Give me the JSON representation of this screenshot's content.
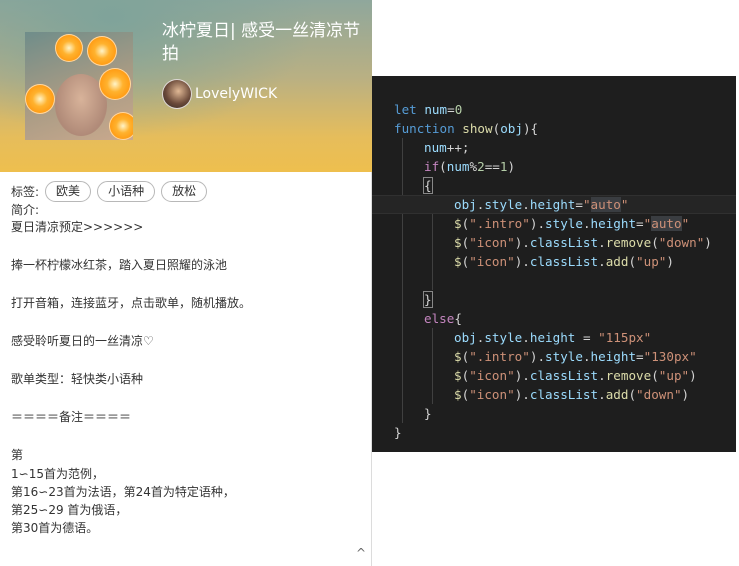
{
  "playlist": {
    "title": "冰柠夏日| 感受一丝清凉节拍",
    "username": "LovelyWICK",
    "tags_label": "标签:",
    "tags": [
      "欧美",
      "小语种",
      "放松"
    ],
    "intro_label": "简介:",
    "intro_lines": [
      "夏日清凉预定>>>>>>",
      "",
      "捧一杯柠檬冰红茶，踏入夏日照耀的泳池",
      "",
      "打开音箱，连接蓝牙，点击歌单，随机播放。",
      "",
      "感受聆听夏日的一丝清凉♡",
      "",
      "歌单类型：轻快类小语种",
      "",
      "＝＝＝＝备注＝＝＝＝",
      "",
      "第",
      "1∽15首为范例，",
      "第16∽23首为法语，第24首为特定语种，",
      "第25∽29 首为俄语，",
      "第30首为德语。"
    ],
    "collapse_icon": "^"
  },
  "code": {
    "lines": [
      {
        "indent": 0,
        "tokens": [
          [
            "kw",
            "let "
          ],
          [
            "v",
            "num"
          ],
          [
            "p",
            "="
          ],
          [
            "num",
            "0"
          ]
        ]
      },
      {
        "indent": 0,
        "tokens": [
          [
            "kw",
            "function "
          ],
          [
            "fn",
            "show"
          ],
          [
            "p",
            "("
          ],
          [
            "v",
            "obj"
          ],
          [
            "p",
            "){"
          ]
        ]
      },
      {
        "indent": 1,
        "tokens": [
          [
            "v",
            "num"
          ],
          [
            "p",
            "++;"
          ]
        ]
      },
      {
        "indent": 1,
        "tokens": [
          [
            "ctl",
            "if"
          ],
          [
            "p",
            "("
          ],
          [
            "v",
            "num"
          ],
          [
            "p",
            "%"
          ],
          [
            "num",
            "2"
          ],
          [
            "p",
            "=="
          ],
          [
            "num",
            "1"
          ],
          [
            "p",
            ")"
          ]
        ]
      },
      {
        "indent": 1,
        "tokens": [
          [
            "bracket",
            "{"
          ]
        ]
      },
      {
        "indent": 2,
        "current": true,
        "tokens": [
          [
            "v",
            "obj"
          ],
          [
            "p",
            "."
          ],
          [
            "v",
            "style"
          ],
          [
            "p",
            "."
          ],
          [
            "v",
            "height"
          ],
          [
            "p",
            "="
          ],
          [
            "str",
            "\""
          ],
          [
            "str-hl",
            "auto"
          ],
          [
            "str",
            "\""
          ]
        ]
      },
      {
        "indent": 2,
        "tokens": [
          [
            "fn",
            "$"
          ],
          [
            "p",
            "("
          ],
          [
            "str",
            "\".intro\""
          ],
          [
            "p",
            ")."
          ],
          [
            "v",
            "style"
          ],
          [
            "p",
            "."
          ],
          [
            "v",
            "height"
          ],
          [
            "p",
            "="
          ],
          [
            "str",
            "\""
          ],
          [
            "str-hl",
            "auto"
          ],
          [
            "str",
            "\""
          ]
        ]
      },
      {
        "indent": 2,
        "tokens": [
          [
            "fn",
            "$"
          ],
          [
            "p",
            "("
          ],
          [
            "str",
            "\"icon\""
          ],
          [
            "p",
            ")."
          ],
          [
            "v",
            "classList"
          ],
          [
            "p",
            "."
          ],
          [
            "fn",
            "remove"
          ],
          [
            "p",
            "("
          ],
          [
            "str",
            "\"down\""
          ],
          [
            "p",
            ")"
          ]
        ]
      },
      {
        "indent": 2,
        "tokens": [
          [
            "fn",
            "$"
          ],
          [
            "p",
            "("
          ],
          [
            "str",
            "\"icon\""
          ],
          [
            "p",
            ")."
          ],
          [
            "v",
            "classList"
          ],
          [
            "p",
            "."
          ],
          [
            "fn",
            "add"
          ],
          [
            "p",
            "("
          ],
          [
            "str",
            "\"up\""
          ],
          [
            "p",
            ")"
          ]
        ]
      },
      {
        "indent": 2,
        "tokens": []
      },
      {
        "indent": 1,
        "tokens": [
          [
            "bracket",
            "}"
          ]
        ]
      },
      {
        "indent": 1,
        "tokens": [
          [
            "ctl",
            "else"
          ],
          [
            "p",
            "{"
          ]
        ]
      },
      {
        "indent": 2,
        "tokens": [
          [
            "v",
            "obj"
          ],
          [
            "p",
            "."
          ],
          [
            "v",
            "style"
          ],
          [
            "p",
            "."
          ],
          [
            "v",
            "height"
          ],
          [
            "p",
            " = "
          ],
          [
            "str",
            "\"115px\""
          ]
        ]
      },
      {
        "indent": 2,
        "tokens": [
          [
            "fn",
            "$"
          ],
          [
            "p",
            "("
          ],
          [
            "str",
            "\".intro\""
          ],
          [
            "p",
            ")."
          ],
          [
            "v",
            "style"
          ],
          [
            "p",
            "."
          ],
          [
            "v",
            "height"
          ],
          [
            "p",
            "="
          ],
          [
            "str",
            "\"130px\""
          ]
        ]
      },
      {
        "indent": 2,
        "tokens": [
          [
            "fn",
            "$"
          ],
          [
            "p",
            "("
          ],
          [
            "str",
            "\"icon\""
          ],
          [
            "p",
            ")."
          ],
          [
            "v",
            "classList"
          ],
          [
            "p",
            "."
          ],
          [
            "fn",
            "remove"
          ],
          [
            "p",
            "("
          ],
          [
            "str",
            "\"up\""
          ],
          [
            "p",
            ")"
          ]
        ]
      },
      {
        "indent": 2,
        "tokens": [
          [
            "fn",
            "$"
          ],
          [
            "p",
            "("
          ],
          [
            "str",
            "\"icon\""
          ],
          [
            "p",
            ")."
          ],
          [
            "v",
            "classList"
          ],
          [
            "p",
            "."
          ],
          [
            "fn",
            "add"
          ],
          [
            "p",
            "("
          ],
          [
            "str",
            "\"down\""
          ],
          [
            "p",
            ")"
          ]
        ]
      },
      {
        "indent": 1,
        "tokens": [
          [
            "p",
            "}"
          ]
        ]
      },
      {
        "indent": 0,
        "tokens": [
          [
            "p",
            "}"
          ]
        ]
      }
    ]
  },
  "colors": {
    "editor_bg": "#1e1e1e",
    "keyword": "#569cd6",
    "control": "#c586c0",
    "function": "#dcdcaa",
    "string": "#ce9178",
    "number": "#b5cea8",
    "variable": "#9cdcfe"
  }
}
